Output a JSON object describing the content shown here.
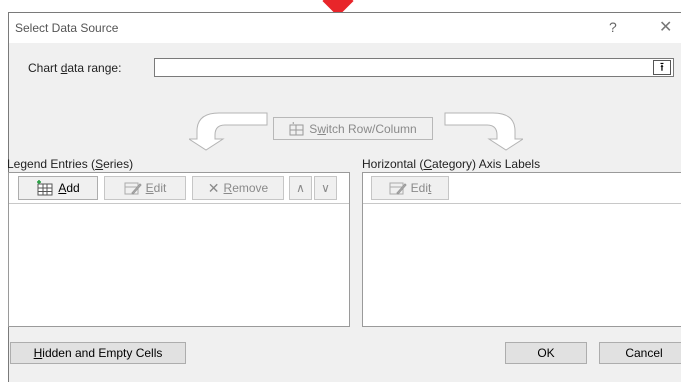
{
  "dialog": {
    "title": "Select Data Source",
    "help_glyph": "?",
    "close_glyph": "✕"
  },
  "range": {
    "label_pre": "Chart ",
    "label_u": "d",
    "label_post": "ata range:",
    "value": "",
    "collapse_glyph": "⭱"
  },
  "switch": {
    "pre": "S",
    "u": "w",
    "post": "itch Row/Column"
  },
  "legend": {
    "label_pre": "Legend Entries (",
    "label_u": "S",
    "label_post": "eries)",
    "add": {
      "u": "A",
      "post": "dd"
    },
    "edit": {
      "u": "E",
      "post": "dit"
    },
    "remove": {
      "u": "R",
      "post": "emove"
    },
    "up_glyph": "∧",
    "down_glyph": "∨",
    "items": []
  },
  "axis": {
    "label_pre": "Horizontal (",
    "label_u": "C",
    "label_post": "ategory) Axis Labels",
    "edit": {
      "pre": "Edi",
      "u": "t"
    },
    "items": []
  },
  "footer": {
    "hidden_u": "H",
    "hidden_post": "idden and Empty Cells",
    "ok": "OK",
    "cancel": "Cancel"
  },
  "colors": {
    "marker": "#e8252a",
    "dialog_bg": "#f0f0f0",
    "disabled_text": "#8a8a8a"
  }
}
